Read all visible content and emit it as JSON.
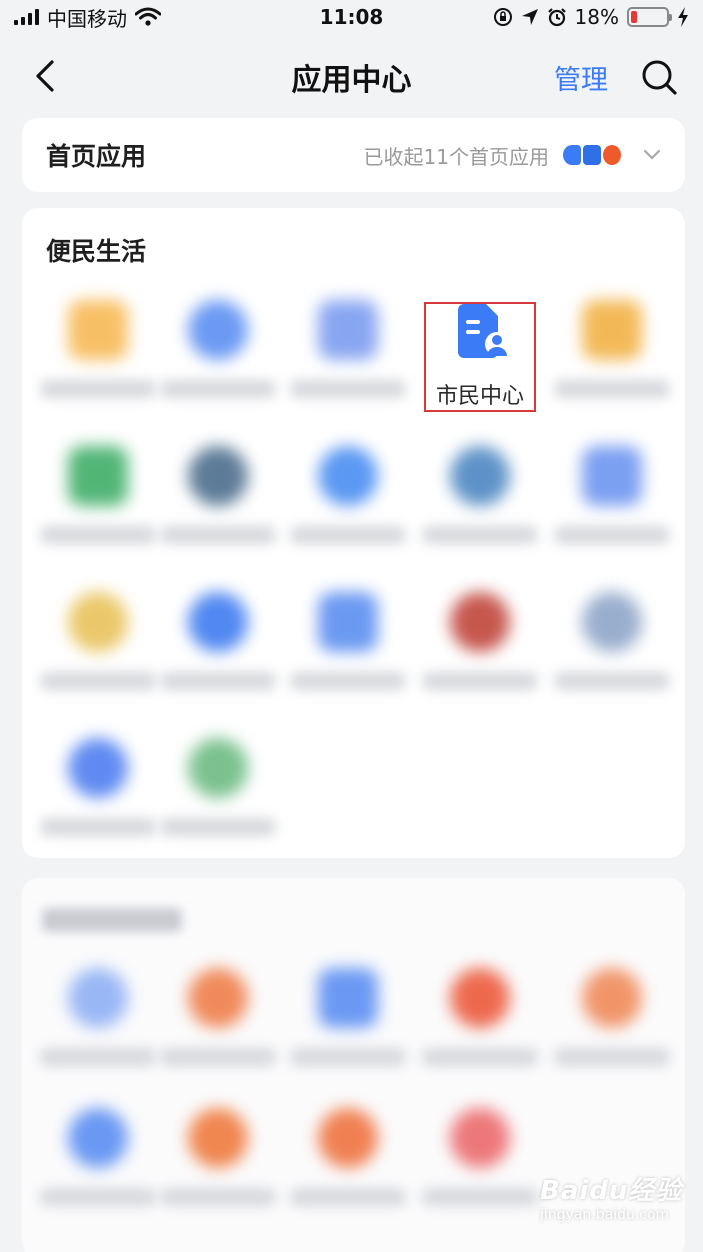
{
  "status_bar": {
    "carrier": "中国移动",
    "time": "11:08",
    "battery_percent": "18%",
    "battery_level": 0.18,
    "battery_color": "#e53935",
    "icons": [
      "signal-icon",
      "wifi-icon",
      "rotation-lock-icon",
      "location-icon",
      "alarm-icon",
      "battery-icon",
      "charging-icon"
    ]
  },
  "nav": {
    "title": "应用中心",
    "manage_label": "管理",
    "accent_color": "#3b7cf6",
    "icons": [
      "back-icon",
      "search-icon"
    ]
  },
  "home_apps": {
    "title": "首页应用",
    "hint": "已收起11个首页应用"
  },
  "life_section": {
    "title": "便民生活",
    "highlighted_app": {
      "label": "市民中心",
      "icon": "citizen-center-icon",
      "highlight_color": "#d9393b"
    }
  },
  "watermark": {
    "main": "Baidu经验",
    "sub": "jingyan.baidu.com"
  }
}
